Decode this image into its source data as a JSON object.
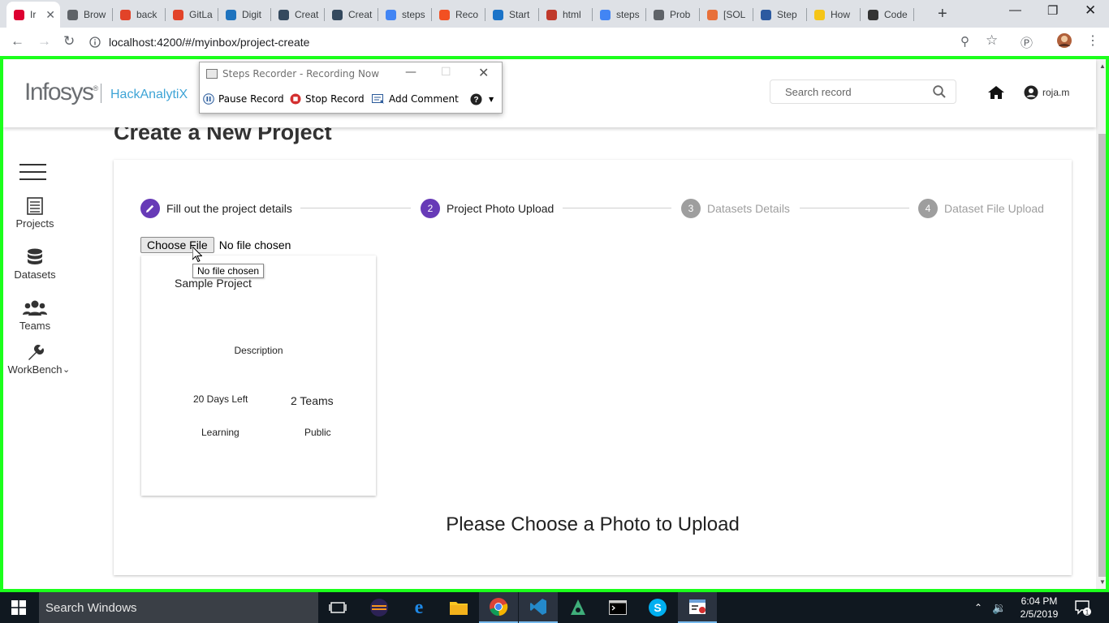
{
  "browser": {
    "tabs": [
      {
        "label": "Ir",
        "favicon": "angular-icon",
        "color": "#dd0031",
        "active": true
      },
      {
        "label": "Brow",
        "favicon": "page-icon",
        "color": "#5f6368"
      },
      {
        "label": "back",
        "favicon": "gitlab-icon",
        "color": "#e24329"
      },
      {
        "label": "GitLa",
        "favicon": "gitlab-icon",
        "color": "#e24329"
      },
      {
        "label": "Digit",
        "favicon": "k-icon",
        "color": "#1e73be"
      },
      {
        "label": "Creat",
        "favicon": "window-icon",
        "color": "#34495e"
      },
      {
        "label": "Creat",
        "favicon": "window-icon",
        "color": "#34495e"
      },
      {
        "label": "steps",
        "favicon": "google-icon",
        "color": "#4285f4"
      },
      {
        "label": "Reco",
        "favicon": "microsoft-icon",
        "color": "#f25022"
      },
      {
        "label": "Start",
        "favicon": "flag-icon",
        "color": "#1a73c8"
      },
      {
        "label": "html",
        "favicon": "n-icon",
        "color": "#c0392b"
      },
      {
        "label": "steps",
        "favicon": "google-icon",
        "color": "#4285f4"
      },
      {
        "label": "Prob",
        "favicon": "page-icon",
        "color": "#5f6368"
      },
      {
        "label": "[SOL",
        "favicon": "gear-icon",
        "color": "#e8703a"
      },
      {
        "label": "Step",
        "favicon": "window-icon",
        "color": "#2c5aa0"
      },
      {
        "label": "How",
        "favicon": "l-icon",
        "color": "#f5c518"
      },
      {
        "label": "Code",
        "favicon": "codepen-icon",
        "color": "#333333"
      }
    ],
    "url": "localhost:4200/#/myinbox/project-create"
  },
  "header": {
    "logo": "Infosys",
    "logo_mark": "®",
    "app_name": "HackAnalytiX",
    "search_placeholder": "Search record",
    "username": "roja.m"
  },
  "sidebar": {
    "items": [
      {
        "label": "Projects",
        "icon": "list-icon"
      },
      {
        "label": "Datasets",
        "icon": "database-icon"
      },
      {
        "label": "Teams",
        "icon": "users-icon"
      },
      {
        "label": "WorkBench",
        "icon": "wrench-icon"
      }
    ]
  },
  "page": {
    "heading": "Create a New Project",
    "steps": [
      {
        "number": "",
        "label": "Fill out the project details",
        "state": "done"
      },
      {
        "number": "2",
        "label": "Project Photo Upload",
        "state": "active"
      },
      {
        "number": "3",
        "label": "Datasets Details",
        "state": "pending"
      },
      {
        "number": "4",
        "label": "Dataset File Upload",
        "state": "pending"
      }
    ],
    "file_input": {
      "button": "Choose File",
      "status": "No file chosen",
      "tooltip": "No file chosen"
    },
    "project_card": {
      "title": "Sample Project",
      "description": "Description",
      "days_left": "20 Days Left",
      "teams": "2 Teams",
      "type": "Learning",
      "visibility": "Public"
    },
    "upload_message": "Please Choose a Photo to Upload"
  },
  "steps_recorder": {
    "title": "Steps Recorder - Recording Now",
    "pause": "Pause Record",
    "stop": "Stop Record",
    "comment": "Add Comment"
  },
  "taskbar": {
    "search": "Search Windows",
    "time": "6:04 PM",
    "date": "2/5/2019",
    "notifications": "1"
  },
  "colors": {
    "accent": "#673ab7",
    "recording_border": "#1bff1b",
    "brand_blue": "#3ea4d6"
  }
}
